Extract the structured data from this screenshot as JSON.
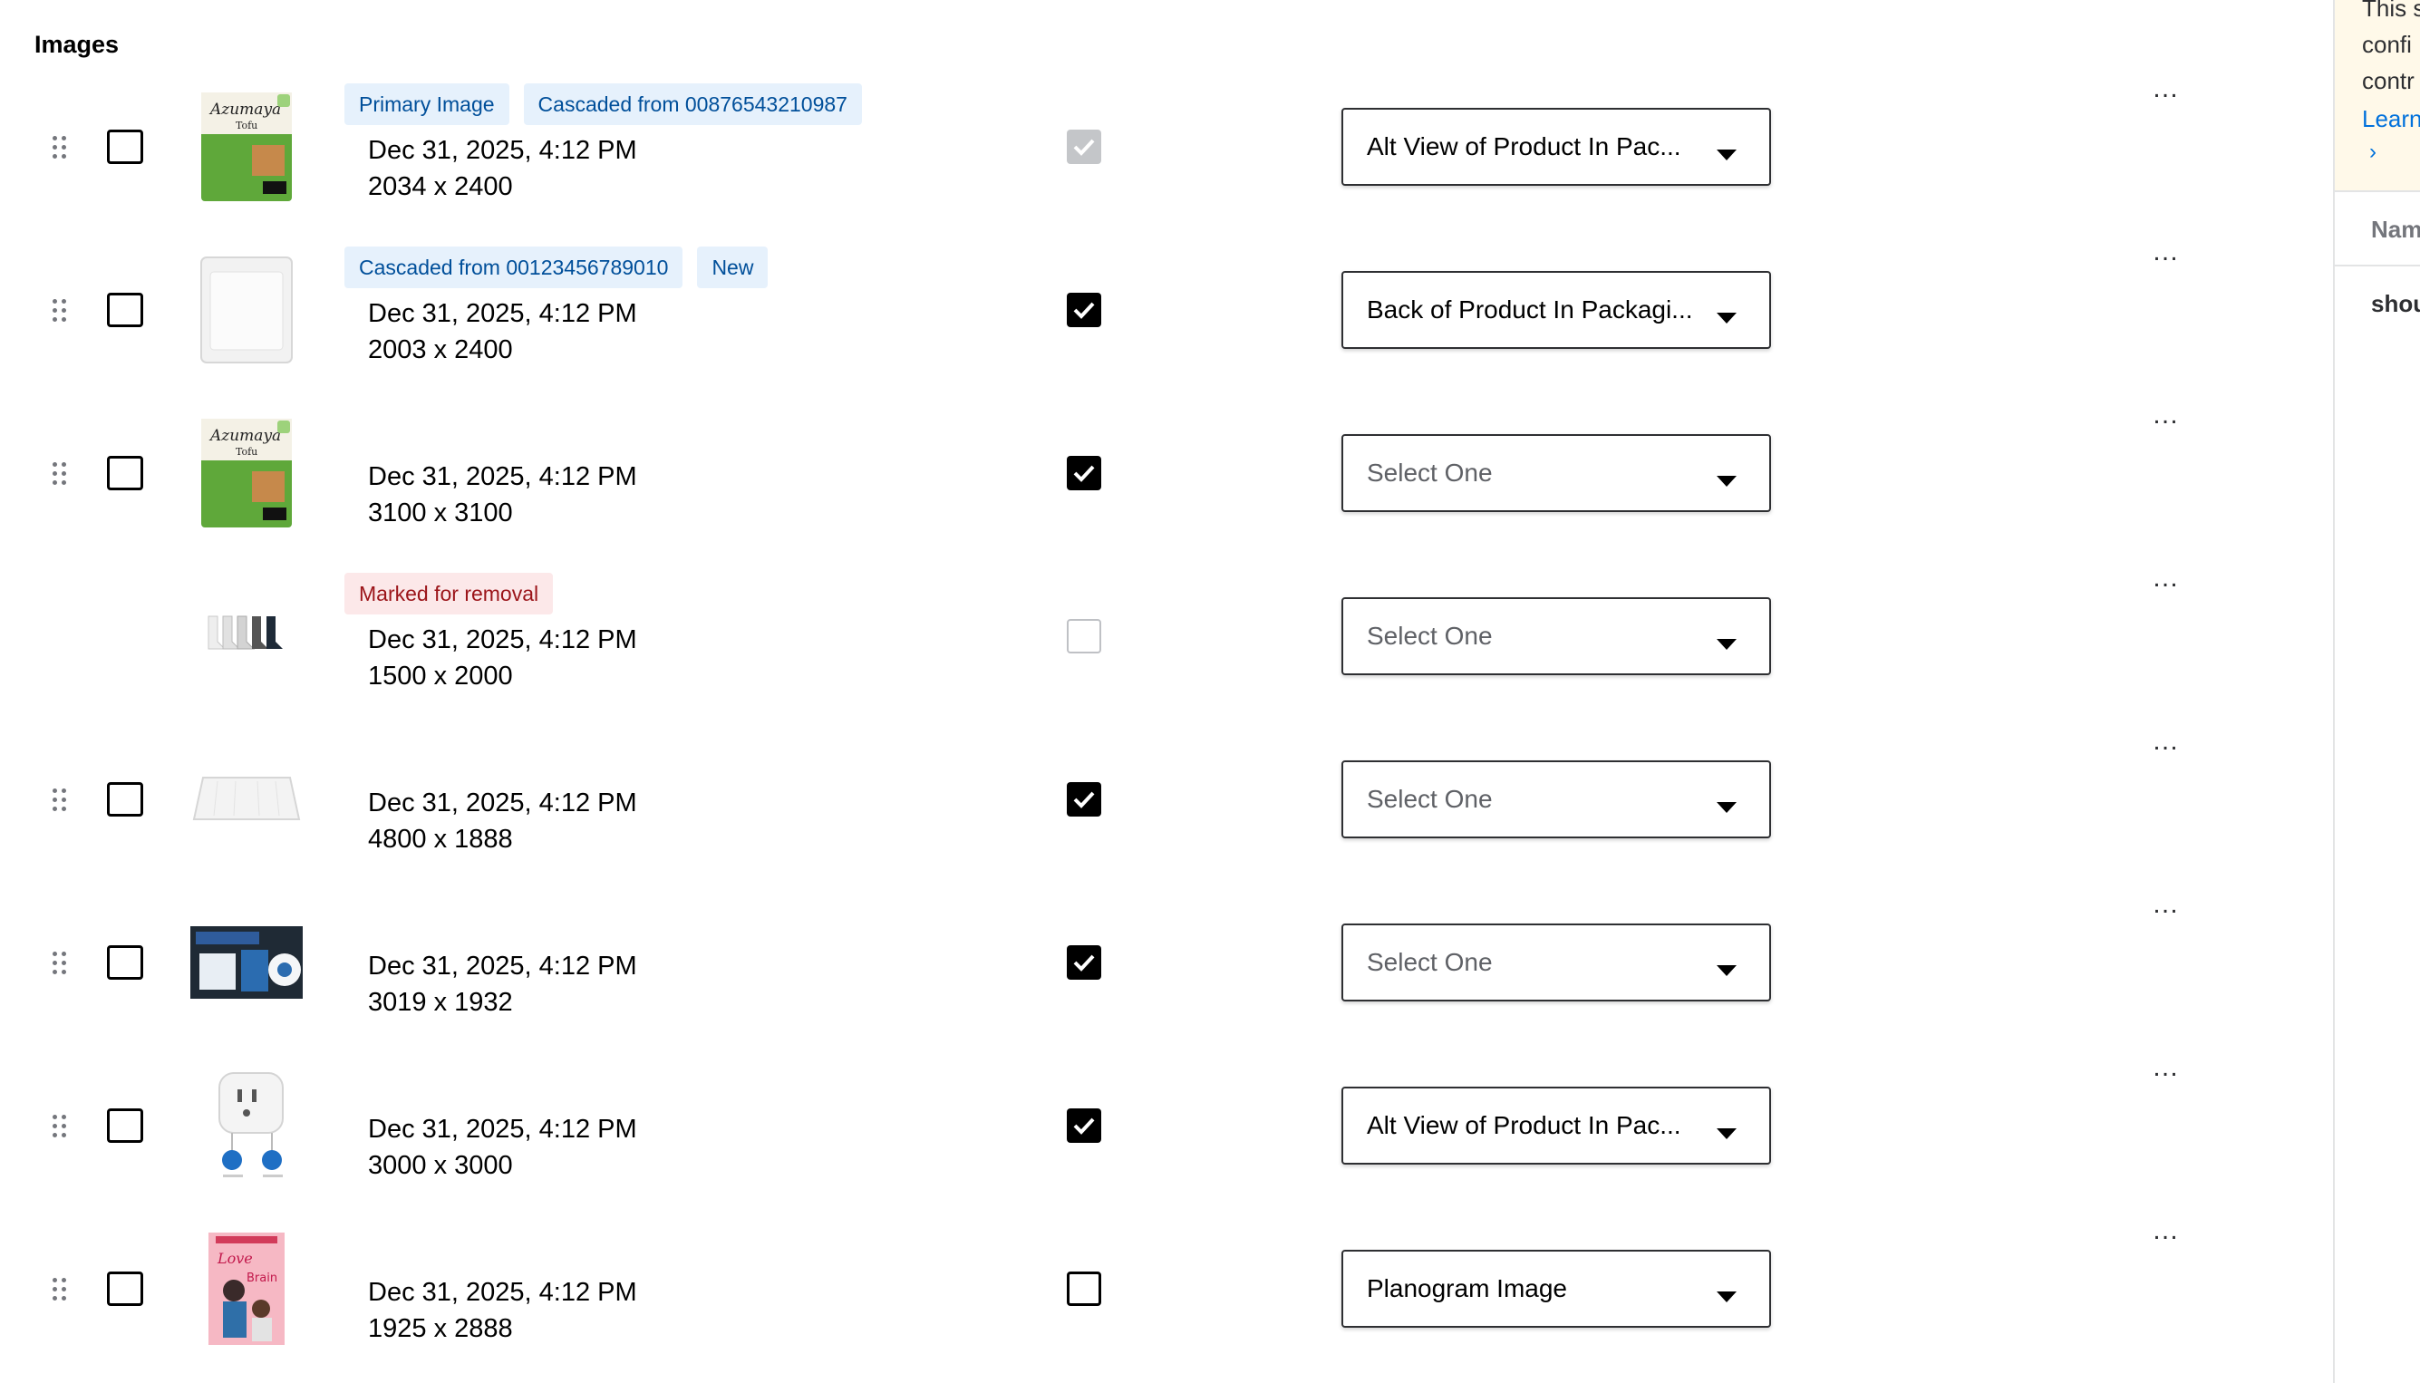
{
  "section": {
    "title": "Images"
  },
  "images": [
    {
      "tags": [
        {
          "label": "Primary Image",
          "kind": "info"
        },
        {
          "label": "Cascaded from 00876543210987",
          "kind": "info"
        }
      ],
      "timestamp": "Dec 31, 2025, 4:12 PM",
      "dimensions": "2034 x 2400",
      "row_checkbox": true,
      "include_state": "checked-disabled",
      "shot_type": "Alt View of Product In Pac...",
      "shot_type_is_placeholder": false,
      "thumbnail": "green tofu package"
    },
    {
      "tags": [
        {
          "label": "Cascaded from 00123456789010",
          "kind": "info"
        },
        {
          "label": "New",
          "kind": "info"
        }
      ],
      "timestamp": "Dec 31, 2025, 4:12 PM",
      "dimensions": "2003 x 2400",
      "row_checkbox": true,
      "include_state": "checked",
      "shot_type": "Back of Product In Packagi...",
      "shot_type_is_placeholder": false,
      "thumbnail": "white tofu package back"
    },
    {
      "tags": [],
      "timestamp": "Dec 31, 2025, 4:12 PM",
      "dimensions": "3100 x 3100",
      "row_checkbox": true,
      "include_state": "checked",
      "shot_type": "Select One",
      "shot_type_is_placeholder": true,
      "thumbnail": "green tofu package"
    },
    {
      "tags": [
        {
          "label": "Marked for removal",
          "kind": "alert"
        }
      ],
      "timestamp": "Dec 31, 2025, 4:12 PM",
      "dimensions": "1500 x 2000",
      "row_checkbox": false,
      "include_state": "empty-disabled",
      "shot_type": "Select One",
      "shot_type_is_placeholder": true,
      "thumbnail": "socks"
    },
    {
      "tags": [],
      "timestamp": "Dec 31, 2025, 4:12 PM",
      "dimensions": "4800 x 1888",
      "row_checkbox": true,
      "include_state": "checked",
      "shot_type": "Select One",
      "shot_type_is_placeholder": true,
      "thumbnail": "white tray"
    },
    {
      "tags": [],
      "timestamp": "Dec 31, 2025, 4:12 PM",
      "dimensions": "3019 x 1932",
      "row_checkbox": true,
      "include_state": "checked",
      "shot_type": "Select One",
      "shot_type_is_placeholder": true,
      "thumbnail": "dark product box"
    },
    {
      "tags": [],
      "timestamp": "Dec 31, 2025, 4:12 PM",
      "dimensions": "3000 x 3000",
      "row_checkbox": true,
      "include_state": "checked",
      "shot_type": "Alt View of Product In Pac...",
      "shot_type_is_placeholder": false,
      "thumbnail": "smart plug"
    },
    {
      "tags": [],
      "timestamp": "Dec 31, 2025, 4:12 PM",
      "dimensions": "1925 x 2888",
      "row_checkbox": true,
      "include_state": "unchecked",
      "shot_type": "Planogram Image",
      "shot_type_is_placeholder": false,
      "thumbnail": "book cover"
    }
  ],
  "side_panel": {
    "banner_lines": [
      "This s",
      "confi",
      "contr"
    ],
    "learn_link": "Learn",
    "chevron": "›",
    "column_header": "Nam",
    "cell_value": "shou"
  },
  "icons": {
    "drag": "drag-handle-icon",
    "more": "more-horizontal-icon",
    "caret": "caret-down-icon",
    "check": "checkmark-icon"
  },
  "colors": {
    "tag_info_bg": "#e6f1fc",
    "tag_info_text": "#004f9a",
    "tag_alert_bg": "#fce8e9",
    "tag_alert_text": "#9b1419",
    "link": "#0071dc",
    "banner_bg": "#fff9e9"
  },
  "more_label": "…"
}
